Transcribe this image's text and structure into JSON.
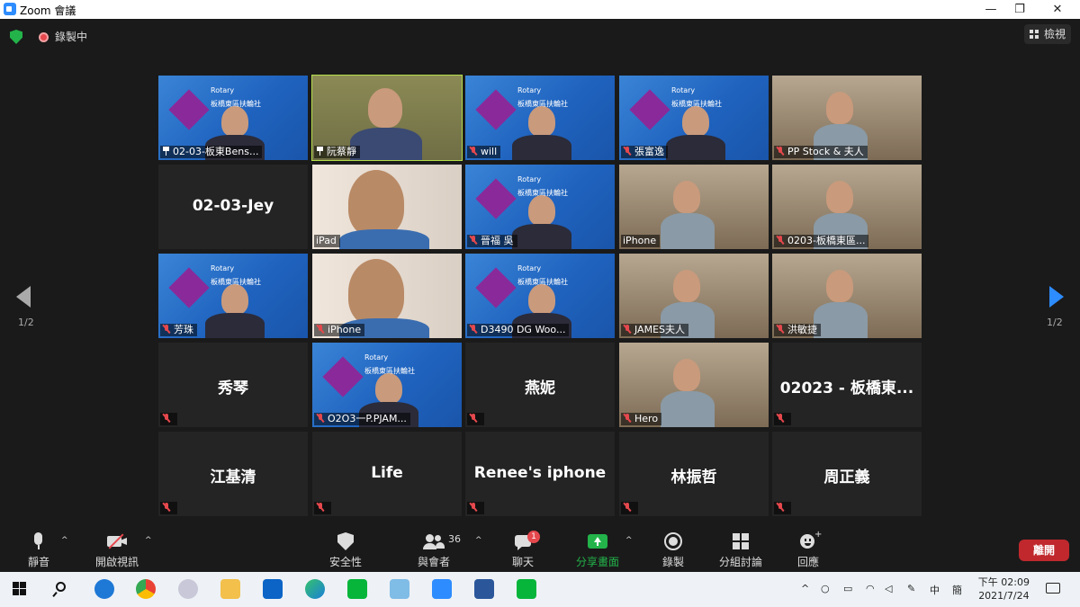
{
  "window": {
    "title": "Zoom 會議",
    "minimize": "—",
    "maximize": "❐",
    "close": "✕"
  },
  "meeting_top": {
    "recording": "錄製中",
    "view_label": "檢視"
  },
  "pager": {
    "left": "1/2",
    "right": "1/2"
  },
  "tiles": [
    {
      "name": "02-03-板東Bens...",
      "pinned": true,
      "muted": false
    },
    {
      "name": "阮蔡靜",
      "pinned": true,
      "muted": false,
      "active": true
    },
    {
      "name": "will",
      "muted": true
    },
    {
      "name": "張富逸",
      "muted": true
    },
    {
      "name": "PP Stock & 夫人",
      "muted": true
    },
    {
      "big": "02-03-Jey"
    },
    {
      "name": "iPad",
      "muted": false
    },
    {
      "name": "晉福 吳",
      "muted": true
    },
    {
      "name": "iPhone",
      "muted": false
    },
    {
      "name": "0203-板橋東區...",
      "muted": true
    },
    {
      "name": "芳珠",
      "muted": true
    },
    {
      "name": "iPhone",
      "muted": true
    },
    {
      "name": "D3490 DG  Woo...",
      "muted": true
    },
    {
      "name": "JAMES夫人",
      "muted": true
    },
    {
      "name": "洪敏捷",
      "muted": true
    },
    {
      "big": "秀琴",
      "muted": true
    },
    {
      "name": "O2O3一P.PJAM...",
      "muted": true
    },
    {
      "big": "燕妮",
      "muted": true
    },
    {
      "name": "Hero",
      "muted": true
    },
    {
      "big": "02023 - 板橋東...",
      "muted": true
    },
    {
      "big": "江基清",
      "muted": true
    },
    {
      "big": "Life",
      "muted": true
    },
    {
      "big": "Renee's iphone",
      "muted": true
    },
    {
      "big": "林振哲",
      "muted": true
    },
    {
      "big": "周正義",
      "muted": true
    }
  ],
  "rotary": {
    "brand": "Rotary",
    "club": "板橋東區扶輪社"
  },
  "toolbar": {
    "mute": "靜音",
    "video": "開啟視訊",
    "security": "安全性",
    "participants": "與會者",
    "participants_count": "36",
    "chat": "聊天",
    "chat_badge": "1",
    "share": "分享畫面",
    "record": "錄製",
    "breakout": "分組討論",
    "reactions": "回應",
    "leave": "離開"
  },
  "taskbar": {
    "time": "下午 02:09",
    "date": "2021/7/24",
    "ime": "中",
    "ime2": "簡"
  },
  "colors": {
    "accent": "#2d8cff",
    "active_outline": "#b5df4a",
    "leave": "#c0282d",
    "share": "#23b34a"
  }
}
